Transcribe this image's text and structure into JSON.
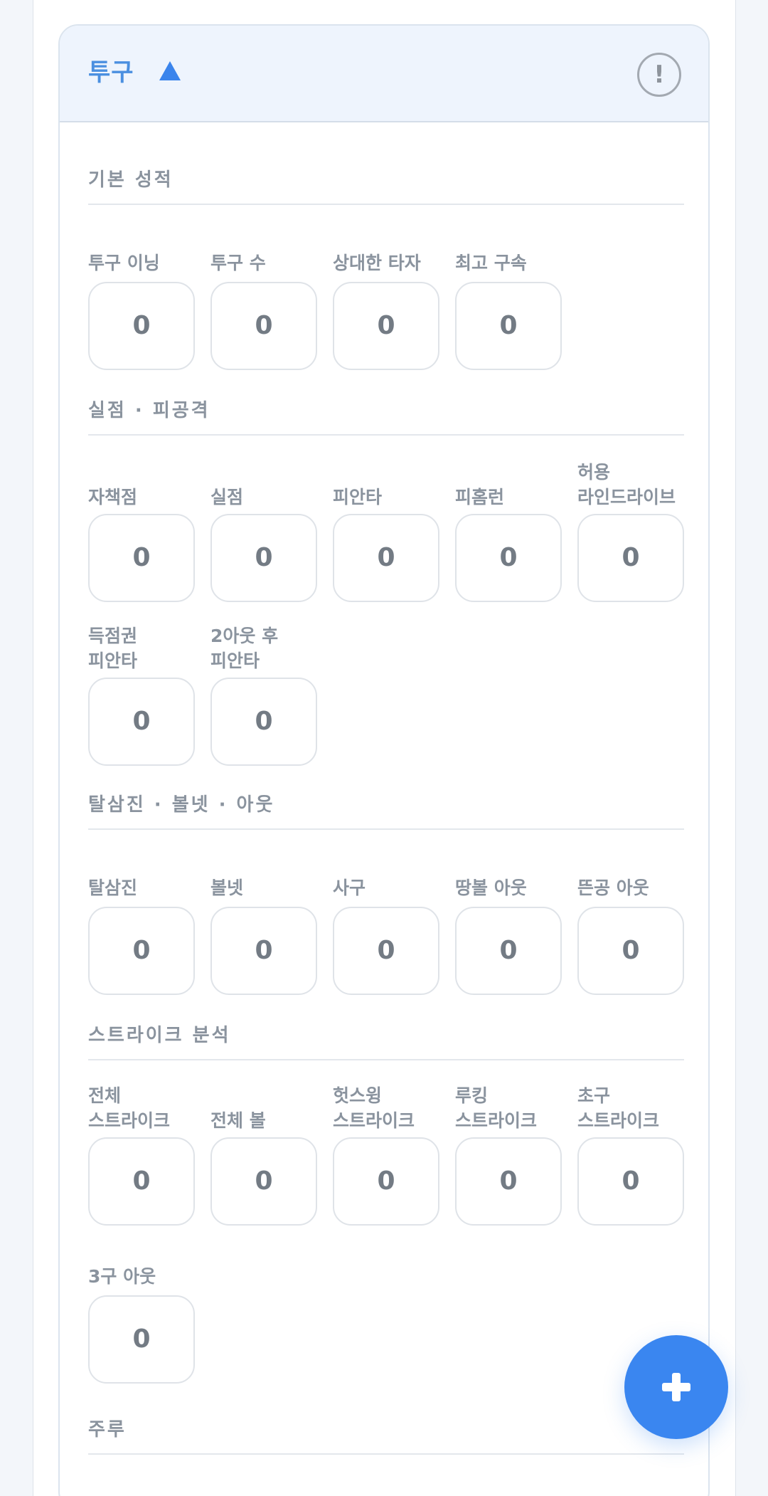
{
  "header": {
    "title": "투구",
    "collapse_icon": "triangle-up-icon",
    "info_icon": "exclamation-circle-icon",
    "info_glyph": "!"
  },
  "sections": [
    {
      "title": "기본 성적",
      "fields": [
        {
          "label": "투구 이닝",
          "value": "0"
        },
        {
          "label": "투구 수",
          "value": "0"
        },
        {
          "label": "상대한 타자",
          "value": "0"
        },
        {
          "label": "최고 구속",
          "value": "0"
        }
      ]
    },
    {
      "title": "실점 · 피공격",
      "fields": [
        {
          "label": "자책점",
          "value": "0"
        },
        {
          "label": "실점",
          "value": "0"
        },
        {
          "label": "피안타",
          "value": "0"
        },
        {
          "label": "피홈런",
          "value": "0"
        },
        {
          "label": "허용\n라인드라이브",
          "value": "0"
        },
        {
          "label": "득점권\n피안타",
          "value": "0"
        },
        {
          "label": "2아웃 후\n피안타",
          "value": "0"
        }
      ]
    },
    {
      "title": "탈삼진 · 볼넷 · 아웃",
      "fields": [
        {
          "label": "탈삼진",
          "value": "0"
        },
        {
          "label": "볼넷",
          "value": "0"
        },
        {
          "label": "사구",
          "value": "0"
        },
        {
          "label": "땅볼 아웃",
          "value": "0"
        },
        {
          "label": "뜬공 아웃",
          "value": "0"
        }
      ]
    },
    {
      "title": "스트라이크 분석",
      "fields": [
        {
          "label": "전체\n스트라이크",
          "value": "0"
        },
        {
          "label": "전체 볼",
          "value": "0"
        },
        {
          "label": "헛스윙\n스트라이크",
          "value": "0"
        },
        {
          "label": "루킹\n스트라이크",
          "value": "0"
        },
        {
          "label": "초구\n스트라이크",
          "value": "0"
        },
        {
          "label": "3구 아웃",
          "value": "0"
        }
      ]
    },
    {
      "title": "주루",
      "fields": []
    }
  ],
  "fab": {
    "icon": "plus-icon"
  },
  "colors": {
    "accent": "#3a86f0",
    "header_bg": "#eef4fd",
    "title_blue": "#4a8fe0",
    "label_gray": "#8a939e",
    "value_gray": "#737b84"
  }
}
